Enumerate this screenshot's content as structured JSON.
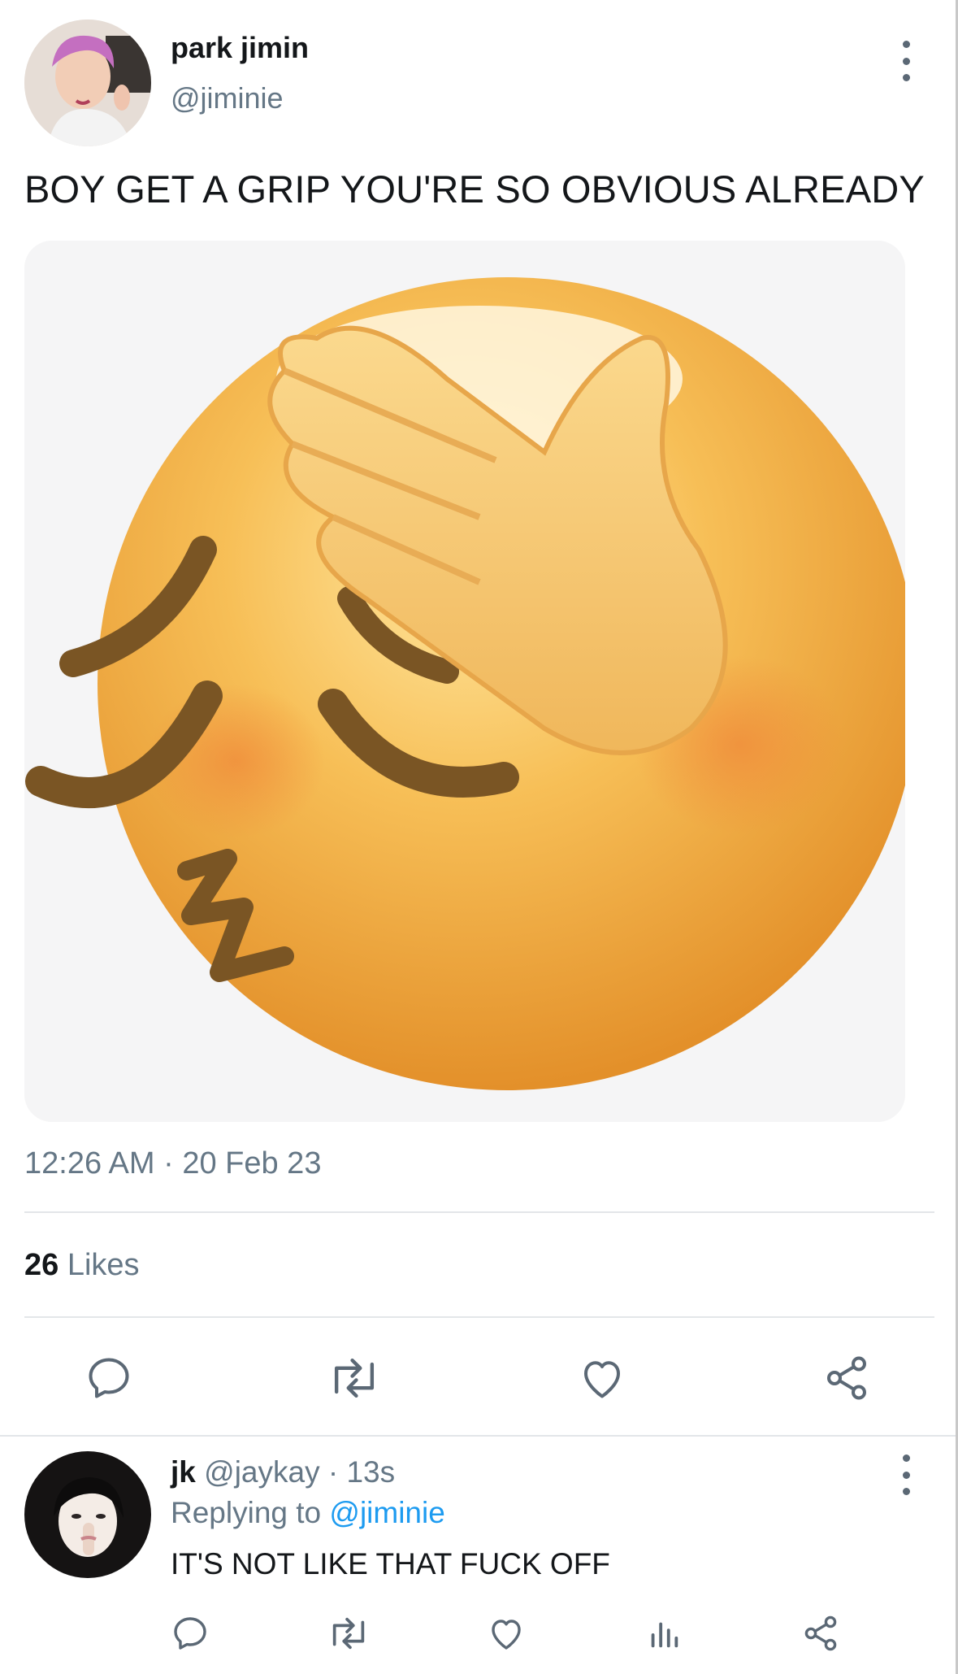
{
  "tweet": {
    "author_name": "park jimin",
    "author_handle": "@jiminie",
    "text": "BOY GET A GRIP YOU'RE SO OBVIOUS ALREADY",
    "media_alt_icon": "face-palm-blushing-emoji",
    "timestamp": "12:26 AM · 20 Feb 23",
    "likes_count": "26",
    "likes_label": "Likes",
    "actions": [
      "reply-icon",
      "retweet-icon",
      "like-icon",
      "share-icon"
    ]
  },
  "reply": {
    "author_name": "jk",
    "author_handle": "@jaykay",
    "separator": "·",
    "time": "13s",
    "replying_prefix": "Replying to",
    "replying_handle": "@jiminie",
    "text": "IT'S NOT LIKE THAT FUCK OFF",
    "actions": [
      "reply-icon",
      "retweet-icon",
      "like-icon",
      "analytics-icon",
      "share-icon"
    ]
  },
  "colors": {
    "text_primary": "#14171a",
    "text_secondary": "#657786",
    "link": "#1d9bf0",
    "divider": "#e3e6e9"
  }
}
